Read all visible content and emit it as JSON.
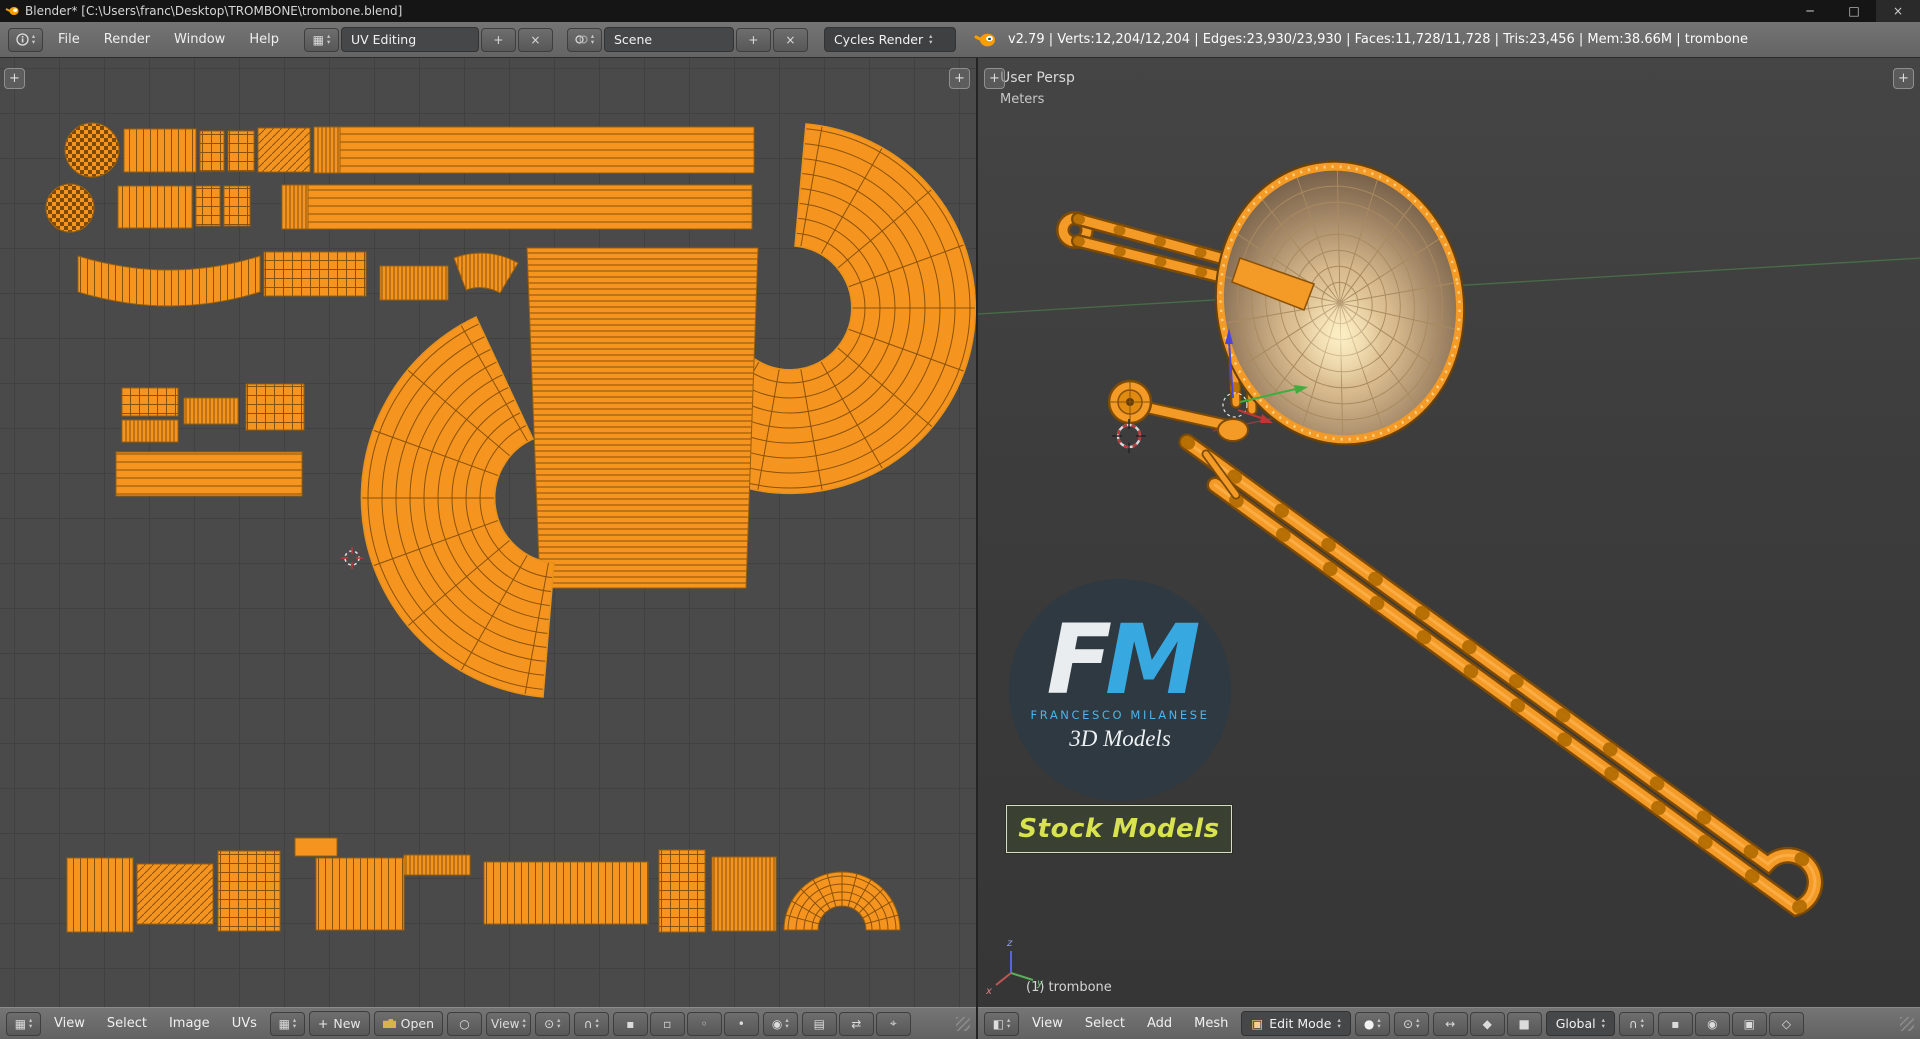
{
  "window": {
    "title": "Blender* [C:\\Users\\franc\\Desktop\\TROMBONE\\trombone.blend]",
    "controls": {
      "minimize": "─",
      "maximize": "□",
      "close": "×"
    }
  },
  "topbar": {
    "menus": [
      "File",
      "Render",
      "Window",
      "Help"
    ],
    "layout": {
      "value": "UV Editing"
    },
    "scene": {
      "value": "Scene"
    },
    "engine": {
      "value": "Cycles Render"
    },
    "stats": "v2.79 | Verts:12,204/12,204 | Edges:23,930/23,930 | Faces:11,728/11,728 | Tris:23,456 | Mem:38.66M | trombone"
  },
  "uv_header": {
    "menus": [
      "View",
      "Select",
      "Image",
      "UVs"
    ],
    "new_label": "New",
    "open_label": "Open",
    "view_dropdown": "View"
  },
  "view_header": {
    "menus": [
      "View",
      "Select",
      "Add",
      "Mesh"
    ],
    "mode": "Edit Mode",
    "orientation": "Global"
  },
  "viewport": {
    "persp_label": "User Persp",
    "units_label": "Meters",
    "object_info": "(1) trombone",
    "axis": {
      "x": "x",
      "y": "y",
      "z": "z"
    }
  },
  "watermark": {
    "f": "F",
    "m": "M",
    "name": "FRANCESCO MILANESE",
    "models": "3D Models",
    "stock": "Stock Models"
  },
  "icons": {
    "tri_up": "▴",
    "tri_down": "▾",
    "plus": "+",
    "close": "×",
    "editor_uv": "▦",
    "editor_3d": "◧",
    "image": "▦",
    "pin": "○",
    "pivot": "⊙",
    "magnet": "∩",
    "sphere": "●",
    "cube": "▣",
    "crosshair": "⌖",
    "snap_a": "▪",
    "snap_b": "▫",
    "snap_c": "◦",
    "snap_d": "•",
    "prop": "◉",
    "sync": "⇄",
    "layers": "▤",
    "manip_move": "↔",
    "manip_rot": "◆",
    "manip_scale": "■",
    "render_a": "▣",
    "render_b": "◇"
  },
  "colors": {
    "accent_orange": "#f5941f",
    "wire_dark": "#8a5208",
    "blue_m": "#38a8e0",
    "stock_text": "#d8e34f",
    "header_gray": "#6b6b6b",
    "uv_canvas_gray": "#4a4a4a",
    "viewport_gray": "#3d3d3d"
  }
}
